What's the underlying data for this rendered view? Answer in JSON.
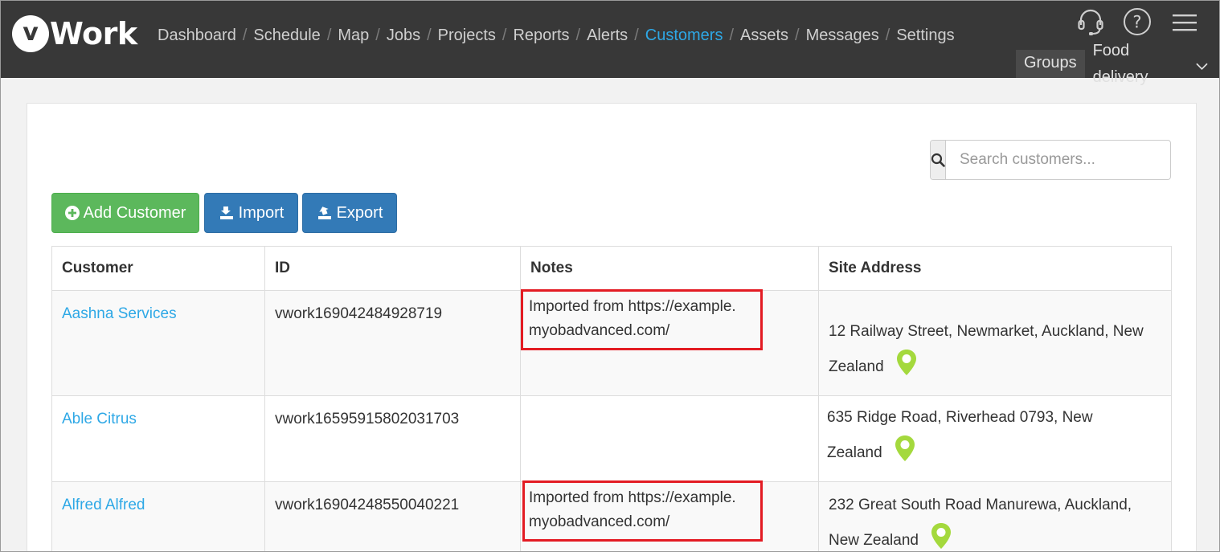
{
  "app": {
    "logo_letter": "v",
    "logo_text": "Work"
  },
  "nav": {
    "items": [
      {
        "label": "Dashboard",
        "active": false
      },
      {
        "label": "Schedule",
        "active": false
      },
      {
        "label": "Map",
        "active": false
      },
      {
        "label": "Jobs",
        "active": false
      },
      {
        "label": "Projects",
        "active": false
      },
      {
        "label": "Reports",
        "active": false
      },
      {
        "label": "Alerts",
        "active": false
      },
      {
        "label": "Customers",
        "active": true
      },
      {
        "label": "Assets",
        "active": false
      },
      {
        "label": "Messages",
        "active": false
      },
      {
        "label": "Settings",
        "active": false
      }
    ],
    "separator": "/"
  },
  "header_icons": [
    "headset-icon",
    "help-icon",
    "hamburger-menu-icon"
  ],
  "groups": {
    "button_label": "Groups",
    "selected": "Food delivery"
  },
  "search": {
    "placeholder": "Search customers...",
    "value": ""
  },
  "actions": {
    "add_label": "Add Customer",
    "import_label": "Import",
    "export_label": "Export"
  },
  "table": {
    "headers": [
      "Customer",
      "ID",
      "Notes",
      "Site Address"
    ],
    "rows": [
      {
        "customer": "Aashna Services",
        "id": "vwork169042484928719",
        "notes_line1": "Imported from https://example.",
        "notes_line2": "myobadvanced.com/",
        "address_line1": "12 Railway Street, Newmarket, Auckland, New",
        "address_line2": "Zealand"
      },
      {
        "customer": "Able Citrus",
        "id": "vwork16595915802031703",
        "notes_line1": "",
        "notes_line2": "",
        "address_line1": "635 Ridge Road, Riverhead 0793, New",
        "address_line2": "Zealand"
      },
      {
        "customer": "Alfred Alfred",
        "id": "vwork16904248550040221",
        "notes_line1": "Imported from https://example.",
        "notes_line2": "myobadvanced.com/",
        "address_line1": "232 Great South Road Manurewa, Auckland,",
        "address_line2": "New Zealand"
      }
    ]
  },
  "colors": {
    "header_bg": "#383838",
    "nav_active": "#2ea8e6",
    "add_button": "#5cb85c",
    "primary_button": "#337ab7",
    "pin": "#a4d93d",
    "highlight_box": "#e31b23"
  }
}
